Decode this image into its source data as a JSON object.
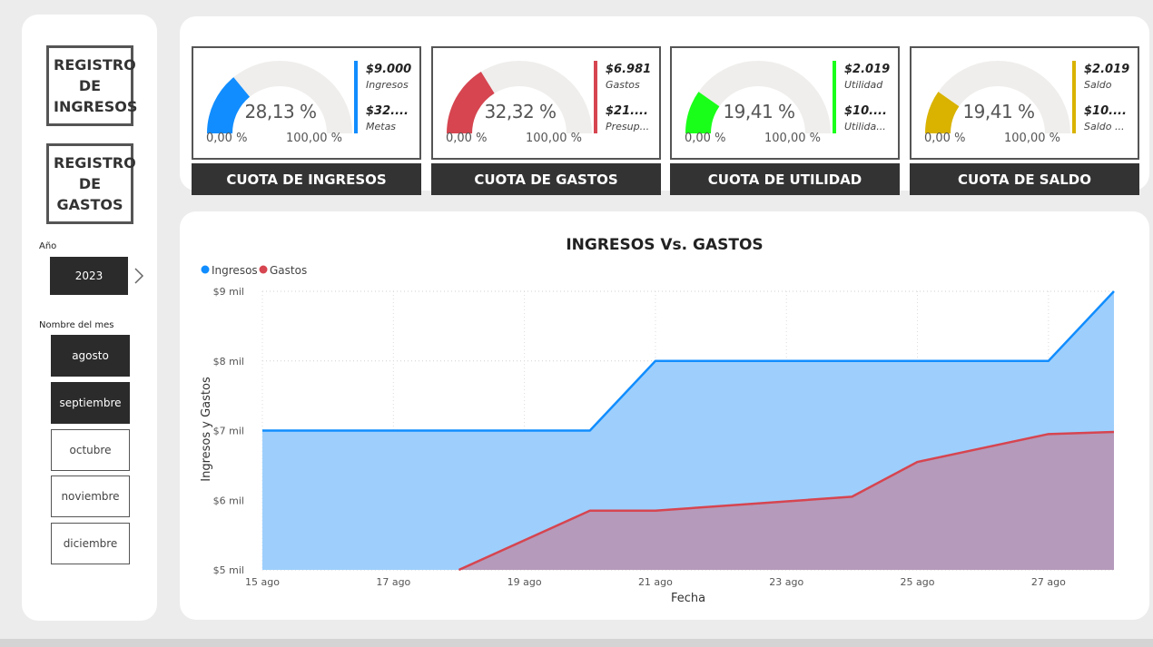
{
  "nav": {
    "ingresos_label": "REGISTRO DE INGRESOS",
    "gastos_label": "REGISTRO DE GASTOS"
  },
  "year_slicer": {
    "label": "Año",
    "value": "2023"
  },
  "month_slicer": {
    "label": "Nombre del mes",
    "months": [
      {
        "name": "agosto",
        "selected": true
      },
      {
        "name": "septiembre",
        "selected": true
      },
      {
        "name": "octubre",
        "selected": false
      },
      {
        "name": "noviembre",
        "selected": false
      },
      {
        "name": "diciembre",
        "selected": false
      }
    ]
  },
  "kpis": [
    {
      "title": "CUOTA DE INGRESOS",
      "percent": "28,13 %",
      "fraction": 0.2813,
      "min": "0,00 %",
      "max": "100,00 %",
      "color": "#118DFF",
      "value1": "$9.000",
      "label1": "Ingresos",
      "value2": "$32....",
      "label2": "Metas"
    },
    {
      "title": "CUOTA DE GASTOS",
      "percent": "32,32 %",
      "fraction": 0.3232,
      "min": "0,00 %",
      "max": "100,00 %",
      "color": "#D64550",
      "value1": "$6.981",
      "label1": "Gastos",
      "value2": "$21....",
      "label2": "Presup..."
    },
    {
      "title": "CUOTA DE UTILIDAD",
      "percent": "19,41 %",
      "fraction": 0.1941,
      "min": "0,00 %",
      "max": "100,00 %",
      "color": "#1AFF1A",
      "value1": "$2.019",
      "label1": "Utilidad",
      "value2": "$10....",
      "label2": "Utilida..."
    },
    {
      "title": "CUOTA DE SALDO",
      "percent": "19,41 %",
      "fraction": 0.1941,
      "min": "0,00 %",
      "max": "100,00 %",
      "color": "#D9B300",
      "value1": "$2.019",
      "label1": "Saldo",
      "value2": "$10....",
      "label2": "Saldo ..."
    }
  ],
  "chart_data": {
    "type": "area",
    "title": "INGRESOS Vs. GASTOS",
    "xlabel": "Fecha",
    "ylabel": "Ingresos y Gastos",
    "x_tick_labels": [
      "15 ago",
      "17 ago",
      "19 ago",
      "21 ago",
      "23 ago",
      "25 ago",
      "27 ago"
    ],
    "y_tick_labels": [
      "$5 mil",
      "$6 mil",
      "$7 mil",
      "$8 mil",
      "$9 mil"
    ],
    "ylim": [
      5000,
      9000
    ],
    "xlim": [
      "15 ago",
      "28 ago"
    ],
    "legend_position": "top-left",
    "grid": true,
    "series": [
      {
        "name": "Ingresos",
        "color": "#118DFF",
        "fill": "#9ECFFC",
        "points": [
          [
            "15 ago",
            7000
          ],
          [
            "20 ago",
            7000
          ],
          [
            "21 ago",
            8000
          ],
          [
            "27 ago",
            8000
          ],
          [
            "28 ago",
            9000
          ]
        ]
      },
      {
        "name": "Gastos",
        "color": "#D64550",
        "fill": "#B59ABB",
        "points": [
          [
            "18 ago",
            5000
          ],
          [
            "20 ago",
            5850
          ],
          [
            "21 ago",
            5850
          ],
          [
            "24 ago",
            6050
          ],
          [
            "25 ago",
            6550
          ],
          [
            "27 ago",
            6950
          ],
          [
            "28 ago",
            6981
          ]
        ]
      }
    ]
  }
}
